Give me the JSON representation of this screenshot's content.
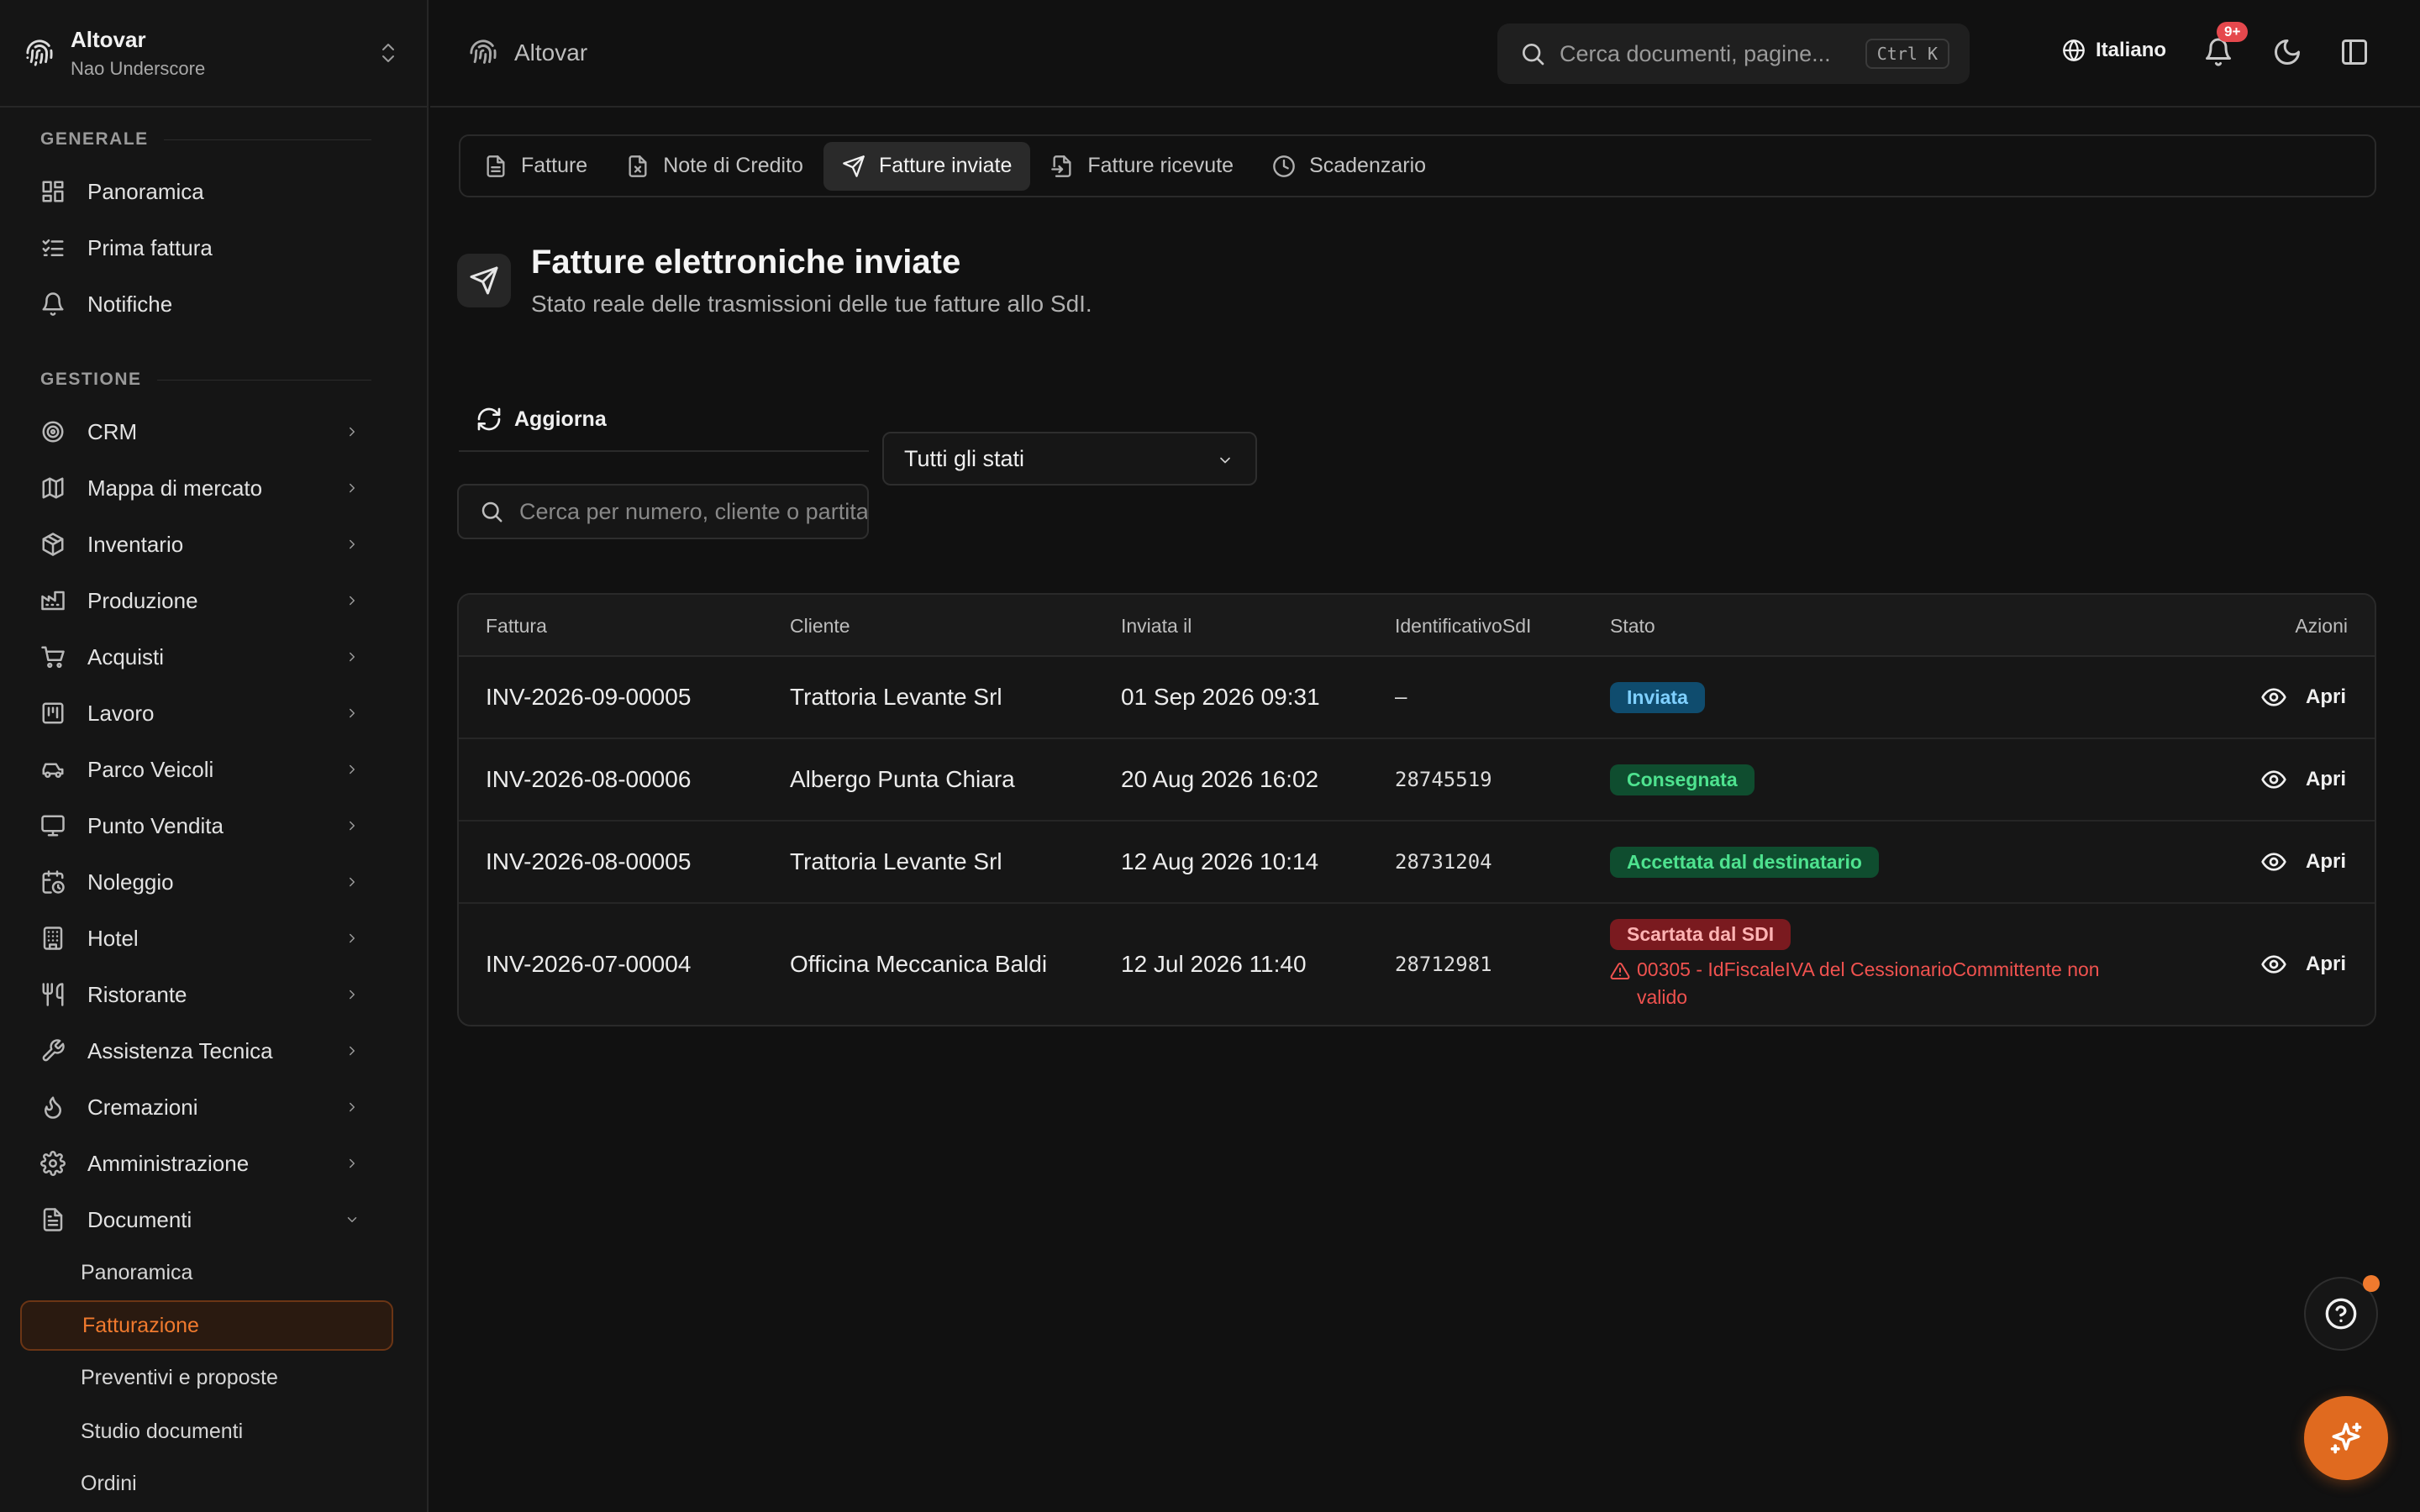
{
  "org": {
    "name": "Altovar",
    "subtitle": "Nao Underscore"
  },
  "sidebar": {
    "sections": [
      {
        "label": "GENERALE"
      },
      {
        "label": "GESTIONE"
      }
    ],
    "general_items": [
      {
        "label": "Panoramica",
        "icon": "dashboard-icon"
      },
      {
        "label": "Prima fattura",
        "icon": "checklist-icon"
      },
      {
        "label": "Notifiche",
        "icon": "bell-icon"
      }
    ],
    "manage_items": [
      {
        "label": "CRM",
        "icon": "target-icon"
      },
      {
        "label": "Mappa di mercato",
        "icon": "map-icon"
      },
      {
        "label": "Inventario",
        "icon": "package-icon"
      },
      {
        "label": "Produzione",
        "icon": "factory-icon"
      },
      {
        "label": "Acquisti",
        "icon": "cart-icon"
      },
      {
        "label": "Lavoro",
        "icon": "kanban-icon"
      },
      {
        "label": "Parco Veicoli",
        "icon": "car-icon"
      },
      {
        "label": "Punto Vendita",
        "icon": "monitor-icon"
      },
      {
        "label": "Noleggio",
        "icon": "calendar-clock-icon"
      },
      {
        "label": "Hotel",
        "icon": "building-icon"
      },
      {
        "label": "Ristorante",
        "icon": "utensils-icon"
      },
      {
        "label": "Assistenza Tecnica",
        "icon": "wrench-icon"
      },
      {
        "label": "Cremazioni",
        "icon": "flame-icon"
      },
      {
        "label": "Amministrazione",
        "icon": "gear-icon"
      },
      {
        "label": "Documenti",
        "icon": "document-icon"
      }
    ],
    "documents_sub": [
      {
        "label": "Panoramica"
      },
      {
        "label": "Fatturazione",
        "active": true
      },
      {
        "label": "Preventivi e proposte"
      },
      {
        "label": "Studio documenti"
      },
      {
        "label": "Ordini"
      }
    ]
  },
  "header": {
    "breadcrumb": "Altovar",
    "search_placeholder": "Cerca documenti, pagine...",
    "search_shortcut": "Ctrl K",
    "language": "Italiano",
    "notification_badge": "9+"
  },
  "tabs": [
    {
      "label": "Fatture",
      "icon": "file-icon"
    },
    {
      "label": "Note di Credito",
      "icon": "file-x-icon"
    },
    {
      "label": "Fatture inviate",
      "icon": "send-icon",
      "active": true
    },
    {
      "label": "Fatture ricevute",
      "icon": "file-import-icon"
    },
    {
      "label": "Scadenzario",
      "icon": "clock-icon"
    }
  ],
  "page": {
    "title": "Fatture elettroniche inviate",
    "subtitle": "Stato reale delle trasmissioni delle tue fatture allo SdI."
  },
  "toolbar": {
    "refresh_label": "Aggiorna",
    "status_filter": "Tutti gli stati",
    "search_placeholder": "Cerca per numero, cliente o partita IVA"
  },
  "table": {
    "columns": [
      "Fattura",
      "Cliente",
      "Inviata il",
      "IdentificativoSdI",
      "Stato",
      "Azioni"
    ],
    "rows": [
      {
        "invoice": "INV-2026-09-00005",
        "client": "Trattoria Levante Srl",
        "sent": "01 Sep 2026 09:31",
        "sdi_id": "–",
        "status": "Inviata",
        "status_color": "#7fd0ff",
        "error": "",
        "action": "Apri"
      },
      {
        "invoice": "INV-2026-08-00006",
        "client": "Albergo Punta Chiara",
        "sent": "20 Aug 2026 16:02",
        "sdi_id": "28745519",
        "status": "Consegnata",
        "status_color": "#4ee28f",
        "error": "",
        "action": "Apri"
      },
      {
        "invoice": "INV-2026-08-00005",
        "client": "Trattoria Levante Srl",
        "sent": "12 Aug 2026 10:14",
        "sdi_id": "28731204",
        "status": "Accettata dal destinatario",
        "status_color": "#4ee28f",
        "error": "",
        "action": "Apri"
      },
      {
        "invoice": "INV-2026-07-00004",
        "client": "Officina Meccanica Baldi",
        "sent": "12 Jul 2026 11:40",
        "sdi_id": "28712981",
        "status": "Scartata dal SDI",
        "status_color": "#ffb3b3",
        "error": "00305 - IdFiscaleIVA del CessionarioCommittente non valido",
        "action": "Apri"
      }
    ]
  },
  "colors": {
    "accent": "#e06a1f",
    "background": "#111111"
  }
}
